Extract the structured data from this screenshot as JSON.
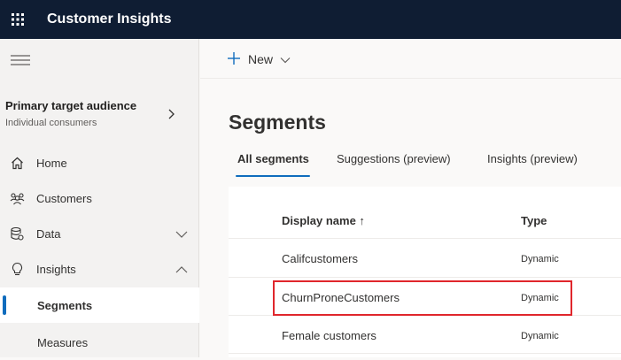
{
  "app": {
    "title": "Customer Insights"
  },
  "audience": {
    "title": "Primary target audience",
    "subtitle": "Individual consumers"
  },
  "nav": {
    "items": [
      {
        "label": "Home",
        "icon": "home-icon"
      },
      {
        "label": "Customers",
        "icon": "customers-icon"
      },
      {
        "label": "Data",
        "icon": "data-icon",
        "expanded": false
      },
      {
        "label": "Insights",
        "icon": "insights-icon",
        "expanded": true
      },
      {
        "label": "Segments",
        "selected": true
      },
      {
        "label": "Measures"
      }
    ]
  },
  "commandbar": {
    "new_label": "New"
  },
  "page": {
    "title": "Segments"
  },
  "tabs": [
    {
      "label": "All segments",
      "active": true
    },
    {
      "label": "Suggestions (preview)"
    },
    {
      "label": "Insights (preview)"
    }
  ],
  "table": {
    "columns": {
      "name": "Display name ↑",
      "type": "Type"
    },
    "rows": [
      {
        "name": "Califcustomers",
        "type": "Dynamic"
      },
      {
        "name": "ChurnProneCustomers",
        "type": "Dynamic",
        "highlighted": true
      },
      {
        "name": "Female customers",
        "type": "Dynamic"
      }
    ]
  },
  "colors": {
    "topbar": "#0f1d33",
    "accent": "#0f6cbd",
    "highlight": "#e0262c"
  }
}
